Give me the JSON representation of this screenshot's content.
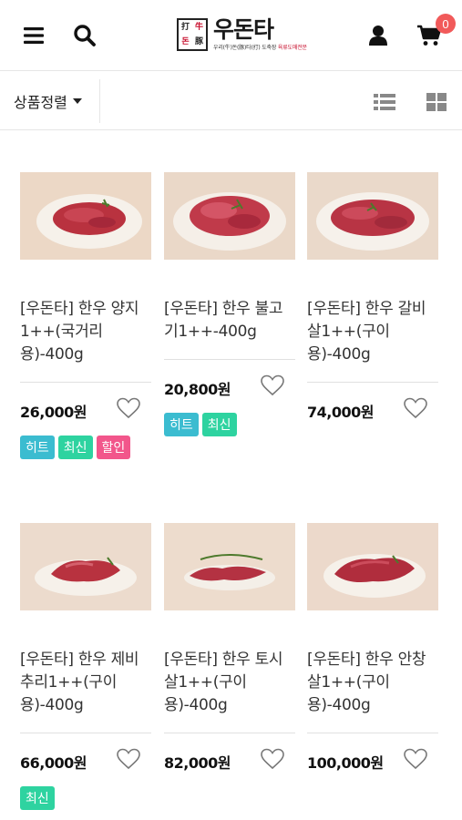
{
  "header": {
    "logo": {
      "name": "우돈타",
      "seal_chars": [
        "打",
        "牛",
        "돈",
        "豚"
      ],
      "tagline": "우리(牛)돈(豚)타(打) 도축장",
      "tagline_highlight": "육류도매전문"
    },
    "cart_count": "0",
    "icons": {
      "menu": "hamburger-icon",
      "search": "search-icon",
      "user": "user-icon",
      "cart": "cart-icon"
    }
  },
  "toolbar": {
    "sort_label": "상품정렬",
    "view_modes": [
      "list-view-icon",
      "grid-view-icon"
    ]
  },
  "badge_labels": {
    "hit": "히트",
    "new": "최신",
    "sale": "할인"
  },
  "colors": {
    "badge_hit": "#3bbcd0",
    "badge_new": "#2ed3a0",
    "badge_sale": "#f2568b",
    "cart_badge": "#f15a5a"
  },
  "products": [
    {
      "name": "[우돈타] 한우 양지1++(국거리용)-400g",
      "price": "26,000원",
      "badges": [
        "히트",
        "최신",
        "할인"
      ]
    },
    {
      "name": "[우돈타] 한우 불고기1++-400g",
      "price": "20,800원",
      "badges": [
        "히트",
        "최신"
      ]
    },
    {
      "name": "[우돈타] 한우 갈비살1++(구이용)-400g",
      "price": "74,000원",
      "badges": []
    },
    {
      "name": "[우돈타] 한우 제비추리1++(구이용)-400g",
      "price": "66,000원",
      "badges": [
        "최신"
      ]
    },
    {
      "name": "[우돈타] 한우 토시살1++(구이용)-400g",
      "price": "82,000원",
      "badges": []
    },
    {
      "name": "[우돈타] 한우 안창살1++(구이용)-400g",
      "price": "100,000원",
      "badges": []
    }
  ]
}
